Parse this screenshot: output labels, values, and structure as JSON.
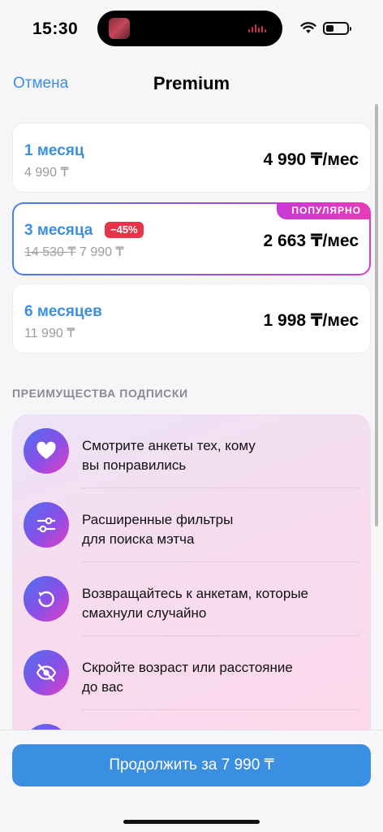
{
  "status_bar": {
    "time": "15:30"
  },
  "nav": {
    "cancel_label": "Отмена",
    "title": "Premium"
  },
  "plans": [
    {
      "name": "1 месяц",
      "old_price": "4 990 ₸",
      "price": "4 990 ₸/мес"
    },
    {
      "name": "3 месяца",
      "discount": "−45%",
      "old_price": "14 530 ₸",
      "current_total": "7 990 ₸",
      "price": "2 663 ₸/мес",
      "badge": "ПОПУЛЯРНО",
      "selected": true
    },
    {
      "name": "6 месяцев",
      "old_price": "11 990 ₸",
      "price": "1 998 ₸/мес"
    }
  ],
  "section_title": "ПРЕИМУЩЕСТВА ПОДПИСКИ",
  "benefits": [
    {
      "icon": "heart-icon",
      "line1": "Смотрите анкеты тех, кому",
      "line2": "вы понравились"
    },
    {
      "icon": "sliders-icon",
      "line1": "Расширенные фильтры",
      "line2": "для поиска мэтча"
    },
    {
      "icon": "rewind-icon",
      "line1": "Возвращайтесь к анкетам, которые",
      "line2": "смахнули случайно"
    },
    {
      "icon": "eye-off-icon",
      "line1": "Скройте возраст или расстояние",
      "line2": "до вас"
    }
  ],
  "cta": {
    "label": "Продолжить за 7 990 ₸"
  },
  "colors": {
    "accent": "#3a8fe0",
    "discount": "#e8344a",
    "gradient_start": "#4f6ff0",
    "gradient_end": "#e33fc4"
  }
}
